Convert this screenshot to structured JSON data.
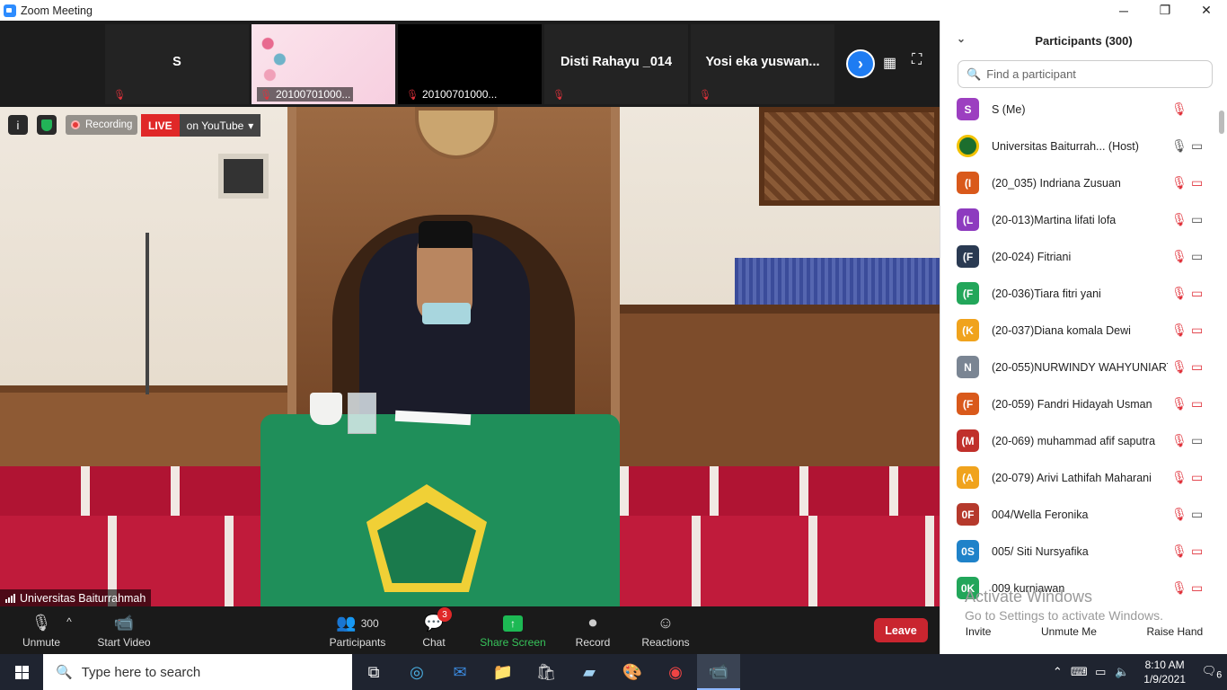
{
  "window": {
    "title": "Zoom Meeting",
    "minimize": "─",
    "maximize": "❐",
    "close": "✕"
  },
  "strip": {
    "tiles": [
      {
        "name": "S",
        "label": ""
      },
      {
        "name": "",
        "label": "20100701000..."
      },
      {
        "name": "",
        "label": "20100701000..."
      },
      {
        "name": "Disti Rahayu _014",
        "label": ""
      },
      {
        "name": "Yosi eka yuswan...",
        "label": ""
      }
    ],
    "next_icon": "›",
    "gallery_icon": "▦",
    "fullscreen_icon": "⛶"
  },
  "overlay": {
    "info_icon": "i",
    "recording": "Recording",
    "live": "LIVE",
    "live_target": "on YouTube",
    "live_caret": "▾",
    "speaker": "Universitas Baiturrahmah"
  },
  "toolbar": {
    "unmute": "Unmute",
    "unmute_caret": "^",
    "start_video": "Start Video",
    "participants": "Participants",
    "participants_count": "300",
    "chat": "Chat",
    "chat_badge": "3",
    "share_screen": "Share Screen",
    "record": "Record",
    "reactions": "Reactions",
    "leave": "Leave"
  },
  "panel": {
    "title": "Participants (300)",
    "search_placeholder": "Find a participant",
    "participants": [
      {
        "initials": "S",
        "name": "S (Me)",
        "color": "#9c3fc0",
        "mic": "muted",
        "video": ""
      },
      {
        "initials": "",
        "name": "Universitas Baiturrah...  (Host)",
        "color": "#1c6e2e",
        "mic": "on",
        "video": "on"
      },
      {
        "initials": "(I",
        "name": "(20_035) Indriana Zusuan",
        "color": "#d9591b",
        "mic": "muted",
        "video": "off"
      },
      {
        "initials": "(L",
        "name": "(20-013)Martina lifati lofa",
        "color": "#8d3bbf",
        "mic": "muted",
        "video": "on"
      },
      {
        "initials": "(F",
        "name": "(20-024) Fitriani",
        "color": "#2a3a52",
        "mic": "muted",
        "video": "on"
      },
      {
        "initials": "(F",
        "name": "(20-036)Tiara fitri yani",
        "color": "#22a65a",
        "mic": "muted",
        "video": "off"
      },
      {
        "initials": "(K",
        "name": "(20-037)Diana komala Dewi",
        "color": "#f0a31d",
        "mic": "muted",
        "video": "off"
      },
      {
        "initials": "N",
        "name": "(20-055)NURWINDY WAHYUNIARTI",
        "color": "#7a8593",
        "mic": "muted",
        "video": "off"
      },
      {
        "initials": "(F",
        "name": "(20-059) Fandri Hidayah Usman",
        "color": "#d9591b",
        "mic": "muted",
        "video": "off"
      },
      {
        "initials": "(M",
        "name": "(20-069) muhammad afif saputra",
        "color": "#c0302b",
        "mic": "muted",
        "video": "on"
      },
      {
        "initials": "(A",
        "name": "(20-079) Arivi Lathifah Maharani",
        "color": "#f0a31d",
        "mic": "muted",
        "video": "off"
      },
      {
        "initials": "0F",
        "name": "004/Wella Feronika",
        "color": "#b5392c",
        "mic": "muted",
        "video": "on"
      },
      {
        "initials": "0S",
        "name": "005/ Siti Nursyafika",
        "color": "#1f82c9",
        "mic": "muted",
        "video": "off"
      },
      {
        "initials": "0K",
        "name": "009 kurniawan",
        "color": "#22a65a",
        "mic": "muted",
        "video": "off"
      }
    ],
    "watermark_title": "Activate Windows",
    "watermark_sub": "Go to Settings to activate Windows.",
    "invite": "Invite",
    "unmute_me": "Unmute Me",
    "raise_hand": "Raise Hand"
  },
  "taskbar": {
    "search_placeholder": "Type here to search",
    "time": "8:10 AM",
    "date": "1/9/2021",
    "notifications": "6"
  }
}
